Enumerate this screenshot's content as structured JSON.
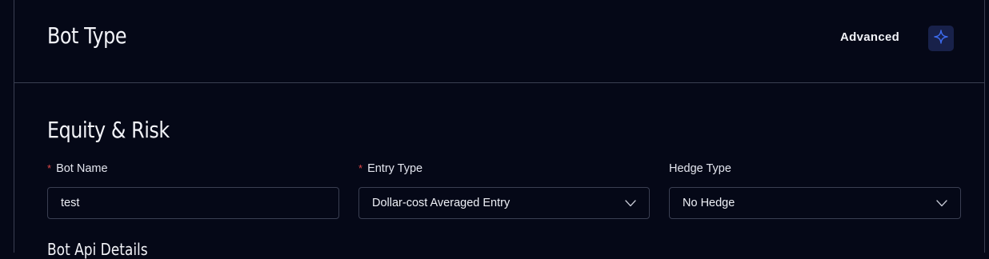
{
  "header": {
    "title": "Bot Type",
    "advanced_label": "Advanced",
    "advanced_icon": "sparkle-icon"
  },
  "equity_risk": {
    "title": "Equity & Risk",
    "required_marker": "*",
    "bot_name": {
      "label": "Bot Name",
      "value": "test"
    },
    "entry_type": {
      "label": "Entry Type",
      "value": "Dollar-cost Averaged Entry"
    },
    "hedge_type": {
      "label": "Hedge Type",
      "value": "No Hedge"
    }
  },
  "bot_api": {
    "title": "Bot Api Details"
  },
  "colors": {
    "background": "#050817",
    "border": "#3a3f52",
    "required": "#e04848",
    "accent": "#3d6cf0",
    "button_bg": "#18214a"
  }
}
